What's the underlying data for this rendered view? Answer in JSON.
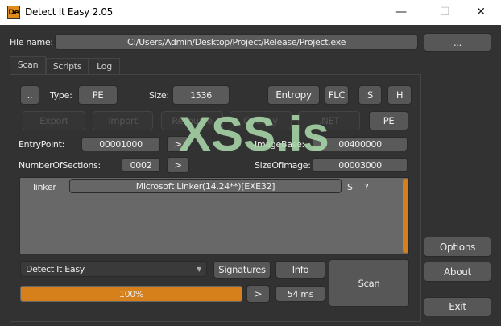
{
  "window": {
    "title": "Detect It Easy 2.05",
    "icon_text": "De",
    "minimize": "—",
    "maximize": "☐",
    "close": "✕"
  },
  "file": {
    "label": "File name:",
    "value": "C:/Users/Admin/Desktop/Project/Release/Project.exe",
    "browse": "..."
  },
  "tabs": [
    "Scan",
    "Scripts",
    "Log"
  ],
  "scan": {
    "up": "..",
    "type_label": "Type:",
    "type_value": "PE",
    "size_label": "Size:",
    "size_value": "1536",
    "entropy": "Entropy",
    "flc": "FLC",
    "s": "S",
    "h": "H",
    "disabled": [
      "Export",
      "Import",
      "Resource",
      "Overlay",
      ".NET"
    ],
    "pe": "PE",
    "entrypoint_label": "EntryPoint:",
    "entrypoint_value": "00001000",
    "go": ">",
    "imagebase_label": "ImageBase:",
    "imagebase_value": "00400000",
    "sections_label": "NumberOfSections:",
    "sections_value": "0002",
    "sizeofimage_label": "SizeOfImage:",
    "sizeofimage_value": "00003000"
  },
  "results": [
    {
      "type": "linker",
      "name": "Microsoft Linker(14.24**)[EXE32]",
      "s": "S",
      "q": "?"
    }
  ],
  "bottom": {
    "engine": "Detect It Easy",
    "signatures": "Signatures",
    "info": "Info",
    "scan": "Scan",
    "progress_text": "100%",
    "progress": 100,
    "more": ">",
    "time": "54 ms"
  },
  "side": {
    "options": "Options",
    "about": "About",
    "exit": "Exit"
  },
  "watermark": "XSS.is",
  "colors": {
    "accent": "#d6801c"
  }
}
